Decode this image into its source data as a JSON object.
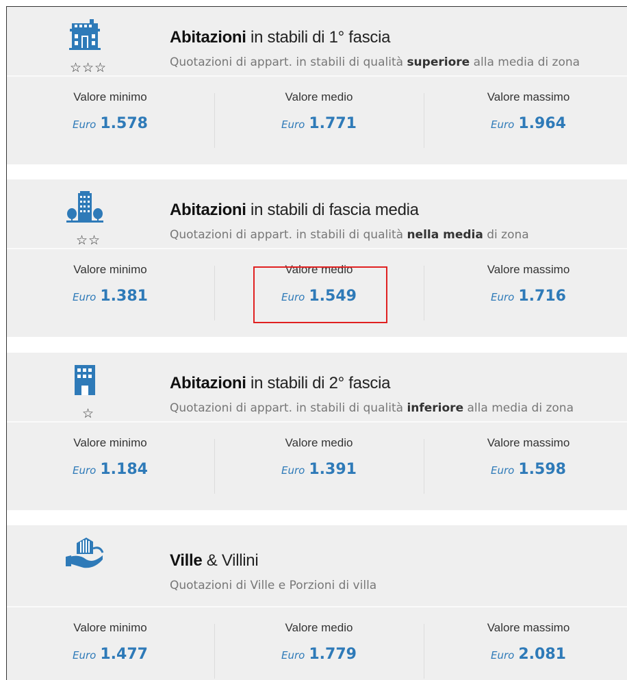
{
  "labels": {
    "min": "Valore minimo",
    "med": "Valore medio",
    "max": "Valore massimo",
    "euro": "Euro"
  },
  "colors": {
    "accent": "#2e7ab8",
    "highlight": "#e02020",
    "card_bg": "#efefef"
  },
  "categories": [
    {
      "icon": "townhouse-building-icon",
      "stars": "☆☆☆",
      "title_bold": "Abitazioni",
      "title_rest": " in stabili di 1° fascia",
      "sub_pre": "Quotazioni di appart. in stabili di qualità ",
      "sub_bold": "superiore",
      "sub_post": " alla media di zona",
      "min": "1.578",
      "med": "1.771",
      "max": "1.964"
    },
    {
      "icon": "apartment-building-trees-icon",
      "stars": "☆☆",
      "title_bold": "Abitazioni",
      "title_rest": " in stabili di fascia media",
      "sub_pre": "Quotazioni di appart. in stabili di qualità ",
      "sub_bold": "nella media",
      "sub_post": " di zona",
      "min": "1.381",
      "med": "1.549",
      "max": "1.716"
    },
    {
      "icon": "office-building-icon",
      "stars": "☆",
      "title_bold": "Abitazioni",
      "title_rest": " in stabili di 2° fascia",
      "sub_pre": "Quotazioni di appart. in stabili di qualità ",
      "sub_bold": "inferiore",
      "sub_post": " alla media di zona",
      "min": "1.184",
      "med": "1.391",
      "max": "1.598"
    },
    {
      "icon": "house-in-hand-icon",
      "stars": "",
      "title_bold": "Ville",
      "title_rest": " & Villini",
      "sub_pre": "Quotazioni di Ville e Porzioni di villa",
      "sub_bold": "",
      "sub_post": "",
      "min": "1.477",
      "med": "1.779",
      "max": "2.081"
    }
  ]
}
